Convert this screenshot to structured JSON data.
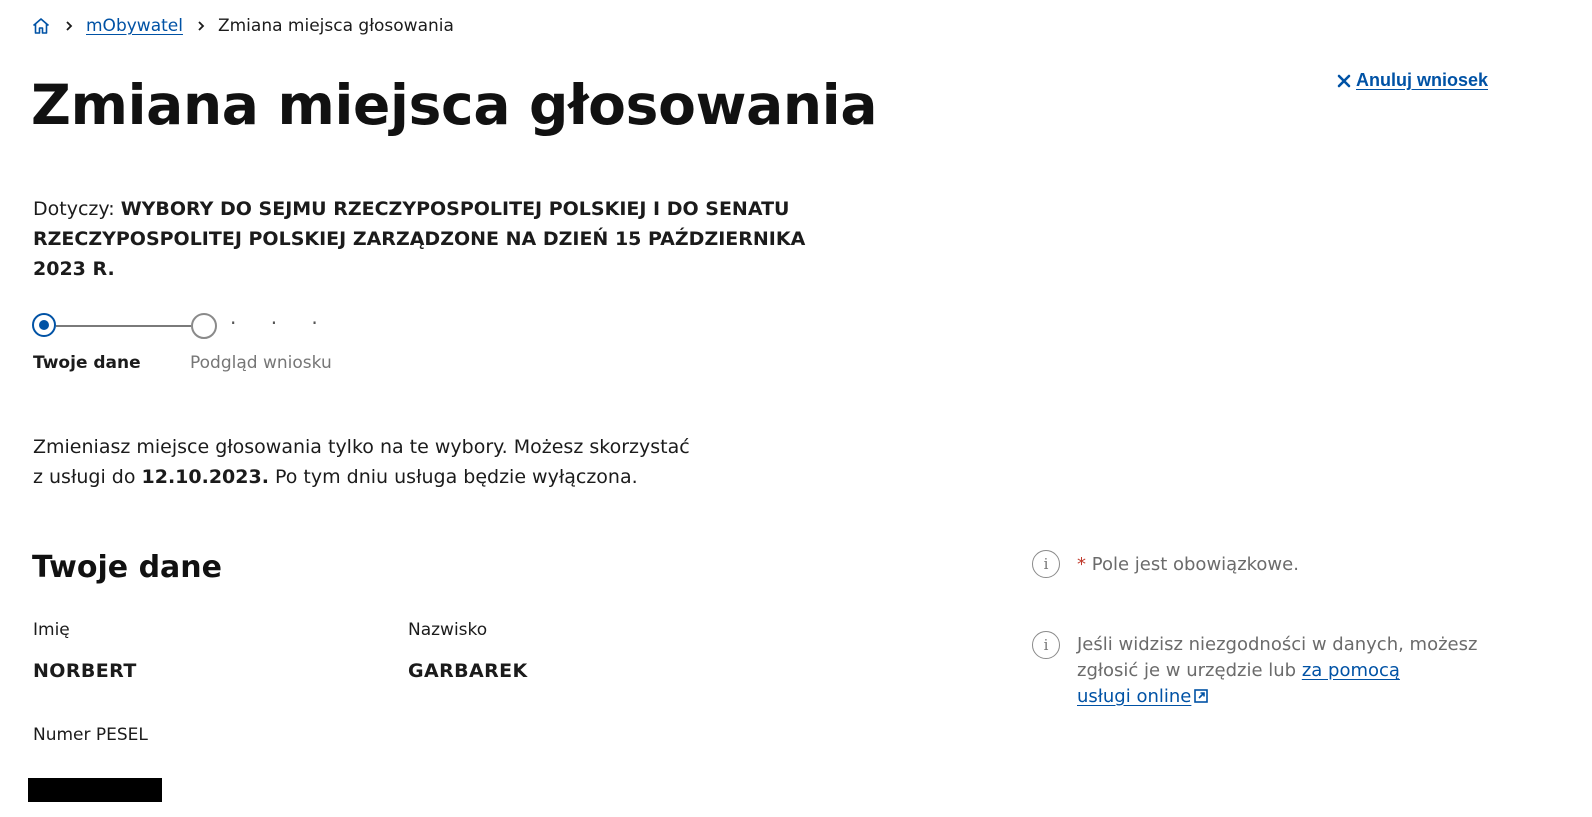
{
  "breadcrumb": {
    "home_icon": "home-icon",
    "link": "mObywatel",
    "current": "Zmiana miejsca głosowania"
  },
  "header": {
    "title": "Zmiana miejsca głosowania",
    "cancel_label": "Anuluj wniosek"
  },
  "concerns": {
    "prefix": "Dotyczy:",
    "value_line1": "WYBORY DO SEJMU RZECZYPOSPOLITEJ POLSKIEJ I DO SENATU",
    "value_line2": "RZECZYPOSPOLITEJ POLSKIEJ ZARZĄDZONE NA DZIEŃ 15 PAŹDZIERNIKA 2023 R."
  },
  "stepper": {
    "steps": [
      {
        "label": "Twoje dane",
        "state": "active"
      },
      {
        "label": "Podgląd wniosku",
        "state": "inactive"
      }
    ],
    "more": "· · ·"
  },
  "info": {
    "line1": "Zmieniasz miejsce głosowania tylko na te wybory. Możesz skorzystać",
    "line2_prefix": "z usługi do",
    "date": "12.10.2023.",
    "line2_suffix": "Po tym dniu usługa będzie wyłączona."
  },
  "section": {
    "title": "Twoje dane",
    "first_name_label": "Imię",
    "first_name": "NORBERT",
    "last_name_label": "Nazwisko",
    "last_name": "GARBAREK",
    "pesel_label": "Numer PESEL"
  },
  "notes": {
    "required_mark": "*",
    "required_text": "Pole jest obowiązkowe.",
    "mismatch_line1": "Jeśli widzisz niezgodności w danych, możesz",
    "mismatch_line2": "zgłosić je w urzędzie lub",
    "mismatch_link_part1": "za pomocą",
    "mismatch_link_part2": "usługi online",
    "info_icon_glyph": "i"
  },
  "colors": {
    "link": "#0052a5",
    "required": "#c0392b",
    "muted": "#6b6b6b"
  }
}
